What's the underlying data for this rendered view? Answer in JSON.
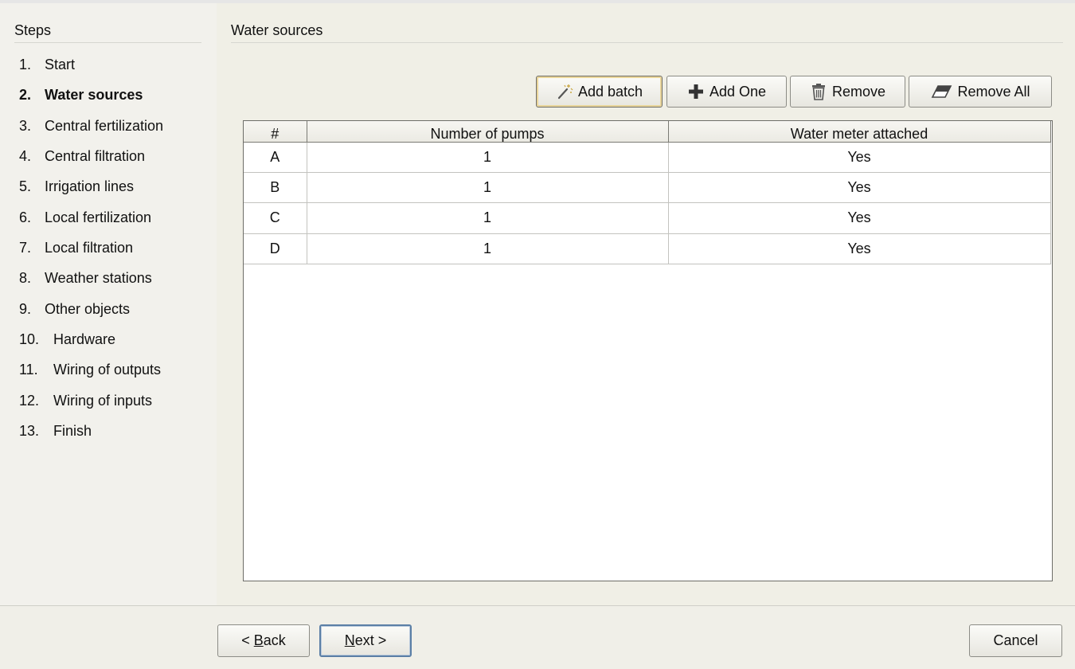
{
  "steps": {
    "title": "Steps",
    "items": [
      {
        "num": "1.",
        "label": "Start"
      },
      {
        "num": "2.",
        "label": "Water sources"
      },
      {
        "num": "3.",
        "label": "Central fertilization"
      },
      {
        "num": "4.",
        "label": "Central filtration"
      },
      {
        "num": "5.",
        "label": "Irrigation lines"
      },
      {
        "num": "6.",
        "label": "Local fertilization"
      },
      {
        "num": "7.",
        "label": "Local filtration"
      },
      {
        "num": "8.",
        "label": "Weather stations"
      },
      {
        "num": "9.",
        "label": "Other objects"
      },
      {
        "num": "10.",
        "label": "Hardware"
      },
      {
        "num": "11.",
        "label": "Wiring of outputs"
      },
      {
        "num": "12.",
        "label": "Wiring of inputs"
      },
      {
        "num": "13.",
        "label": "Finish"
      }
    ],
    "active_index": 1
  },
  "main": {
    "title": "Water sources",
    "toolbar": {
      "add_batch": {
        "label": "Add batch",
        "icon": "magic-wand-icon"
      },
      "add_one": {
        "label": "Add One",
        "icon": "plus-icon"
      },
      "remove": {
        "label": "Remove",
        "icon": "trash-icon"
      },
      "remove_all": {
        "label": "Remove All",
        "icon": "eraser-icon"
      }
    },
    "table": {
      "columns": [
        "#",
        "Number of pumps",
        "Water meter attached"
      ],
      "rows": [
        [
          "A",
          "1",
          "Yes"
        ],
        [
          "B",
          "1",
          "Yes"
        ],
        [
          "C",
          "1",
          "Yes"
        ],
        [
          "D",
          "1",
          "Yes"
        ]
      ]
    }
  },
  "footer": {
    "back": {
      "prefix": "< ",
      "mnemonic": "B",
      "rest": "ack"
    },
    "next": {
      "mnemonic": "N",
      "rest": "ext >"
    },
    "cancel": "Cancel"
  }
}
